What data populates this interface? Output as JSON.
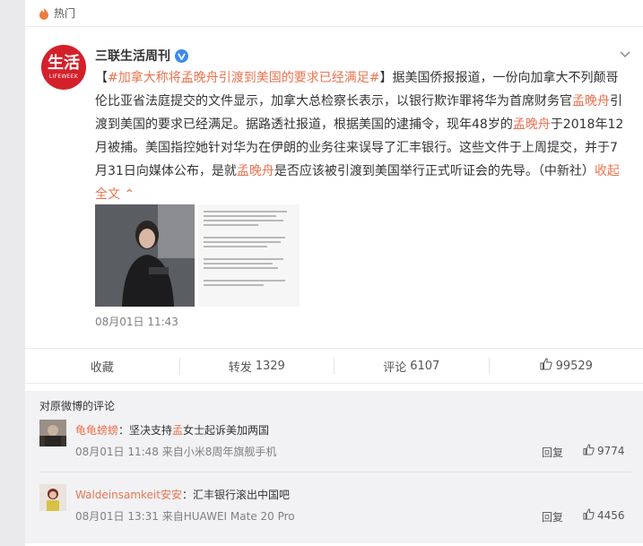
{
  "header": {
    "label": "热门"
  },
  "author": {
    "name": "三联生活周刊",
    "avatar_text_big": "生活",
    "avatar_text_small": "LIFEWEEK"
  },
  "post": {
    "tag": "#加拿大称将孟晚舟引渡到美国的要求已经满足#",
    "segments": [
      {
        "t": "据美国侨报报道，一份向加拿大不列颠哥伦比亚省法庭提交的文件显示，加拿大总检察长表示，以银行欺诈罪将华为首席财务官",
        "hl": false
      },
      {
        "t": "孟晚舟",
        "hl": true
      },
      {
        "t": "引渡到美国的要求已经满足。据路透社报道，根据美国的逮捕令，现年48岁的",
        "hl": false
      },
      {
        "t": "孟晚舟",
        "hl": true
      },
      {
        "t": "于2018年12月被捕。美国指控她针对华为在伊朗的业务往来误导了汇丰银行。这些文件于上周提交，并于7月31日向媒体公布，是就",
        "hl": false
      },
      {
        "t": "孟晚舟",
        "hl": true
      },
      {
        "t": "是否应该被引渡到美国举行正式听证会的先导。（中新社）",
        "hl": false
      }
    ],
    "collapse": "收起全文",
    "timestamp": "08月01日 11:43"
  },
  "actions": {
    "favorite": "收藏",
    "repost_label": "转发",
    "repost_count": "1329",
    "comment_label": "评论",
    "comment_count": "6107",
    "like_count": "99529"
  },
  "comments": {
    "title": "对原微博的评论",
    "items": [
      {
        "user": "龟龟螃螃",
        "pre": "：坚决支持",
        "hl": "孟",
        "post": "女士起诉美加两国",
        "meta": "08月01日 11:48 来自小米8周年旗舰手机",
        "reply": "回复",
        "likes": "9774"
      },
      {
        "user": "Waldeinsamkeit安安",
        "pre": "：汇丰银行滚出中国吧",
        "hl": "",
        "post": "",
        "meta": "08月01日 13:31 来自HUAWEI Mate 20 Pro",
        "reply": "回复",
        "likes": "4456"
      }
    ]
  },
  "colors": {
    "accent": "#eb7350",
    "brand_red": "#d4202b",
    "verified_blue": "#3b8be8"
  }
}
